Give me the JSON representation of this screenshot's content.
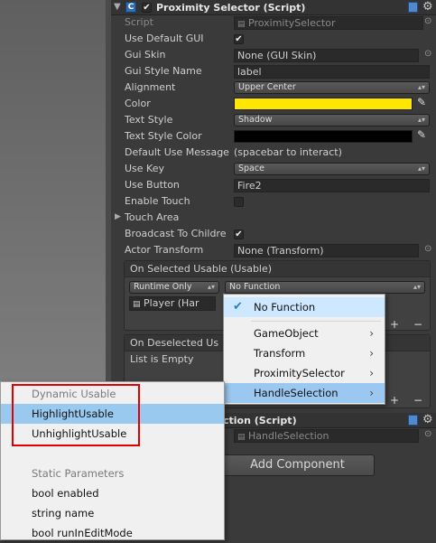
{
  "component": {
    "title": "Proximity Selector (Script)",
    "enabled": true
  },
  "fields": {
    "script": {
      "label": "Script",
      "value": "ProximitySelector"
    },
    "use_default_gui": {
      "label": "Use Default GUI",
      "checked": true
    },
    "gui_skin": {
      "label": "Gui Skin",
      "value": "None (GUI Skin)"
    },
    "gui_style_name": {
      "label": "Gui Style Name",
      "value": "label"
    },
    "alignment": {
      "label": "Alignment",
      "value": "Upper Center"
    },
    "color": {
      "label": "Color",
      "swatch": "#ffe600"
    },
    "text_style": {
      "label": "Text Style",
      "value": "Shadow"
    },
    "text_style_color": {
      "label": "Text Style Color",
      "swatch": "#000000"
    },
    "default_use_message": {
      "label": "Default Use Message",
      "value": "(spacebar to interact)"
    },
    "use_key": {
      "label": "Use Key",
      "value": "Space"
    },
    "use_button": {
      "label": "Use Button",
      "value": "Fire2"
    },
    "enable_touch": {
      "label": "Enable Touch",
      "checked": false
    },
    "touch_area": {
      "label": "Touch Area"
    },
    "broadcast_to_children": {
      "label": "Broadcast To Childre",
      "checked": true
    },
    "actor_transform": {
      "label": "Actor Transform",
      "value": "None (Transform)"
    }
  },
  "on_selected": {
    "header": "On Selected Usable (Usable)",
    "runtime": "Runtime Only",
    "function": "No Function",
    "object": "Player (Har"
  },
  "on_deselected": {
    "header": "On Deselected Us",
    "empty": "List is Empty"
  },
  "second_component": {
    "title_fragment": "ction (Script)",
    "script_value": "HandleSelection"
  },
  "add_component": "Add Component",
  "function_menu": {
    "items": [
      {
        "label": "No Function",
        "checked": true
      },
      {
        "label": "GameObject"
      },
      {
        "label": "Transform"
      },
      {
        "label": "ProximitySelector"
      },
      {
        "label": "HandleSelection"
      }
    ]
  },
  "submenu": {
    "group1": "Dynamic Usable",
    "highlight": "HighlightUsable",
    "unhighlight": "UnhighlightUsable",
    "group2": "Static Parameters",
    "bool_enabled": "bool enabled",
    "string_name": "string name",
    "bool_run": "bool runInEditMode"
  },
  "colors": {
    "highlight": "#99c9ef",
    "annotation": "#e00000"
  }
}
